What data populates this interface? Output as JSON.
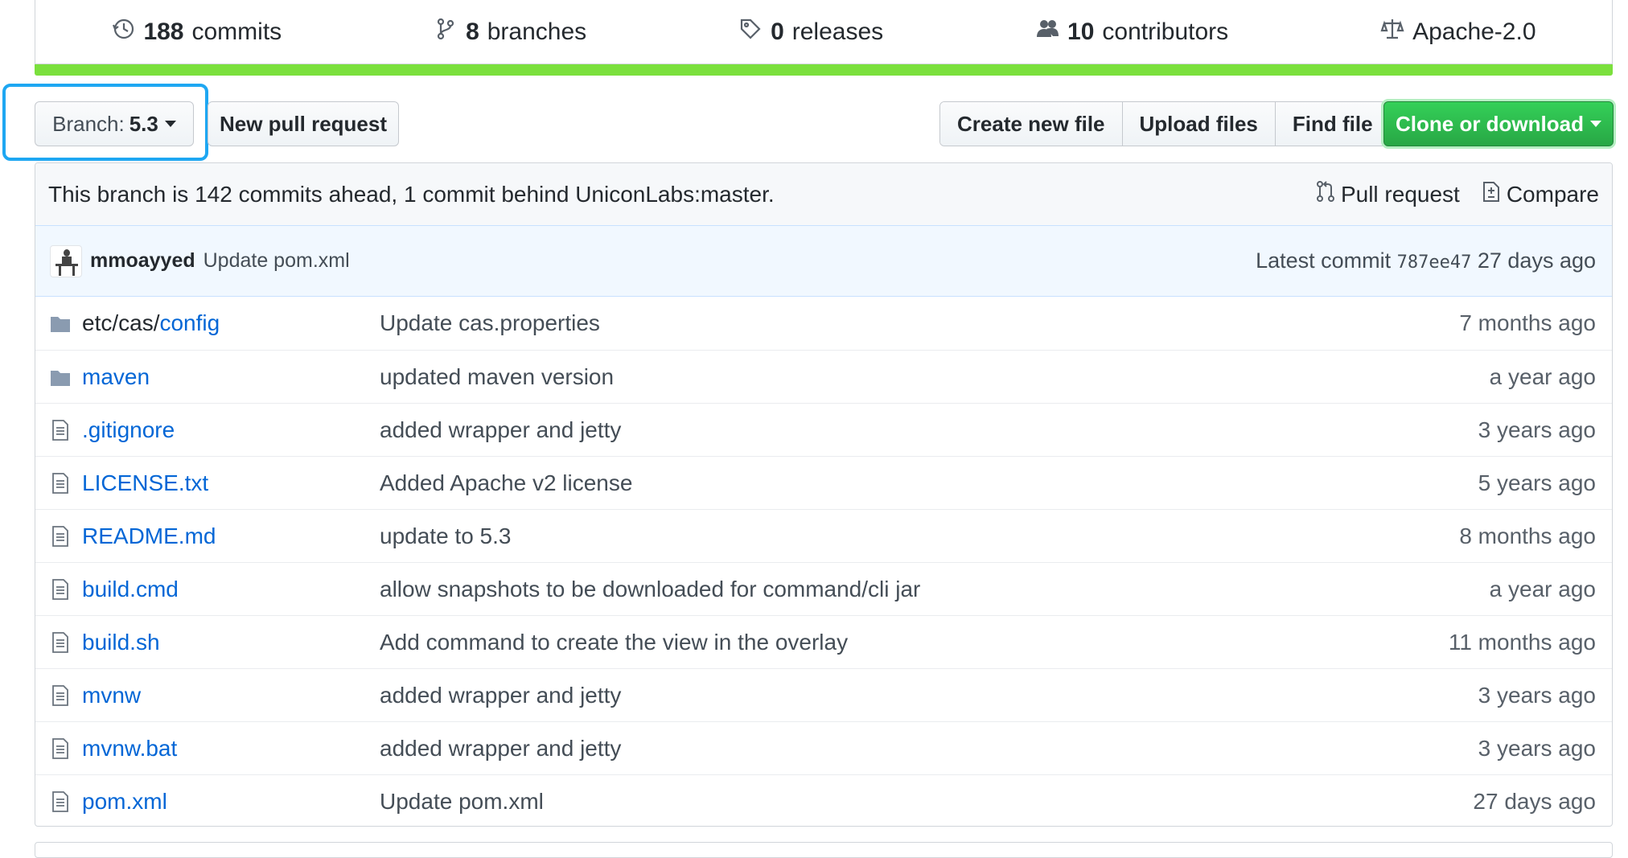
{
  "summary": {
    "commits_count": "188",
    "commits_label": "commits",
    "branches_count": "8",
    "branches_label": "branches",
    "releases_count": "0",
    "releases_label": "releases",
    "contributors_count": "10",
    "contributors_label": "contributors",
    "license": "Apache-2.0",
    "language_bar_color": "#7be03d"
  },
  "toolbar": {
    "branch_prefix": "Branch:",
    "branch_name": "5.3",
    "new_pull_request": "New pull request",
    "create_new_file": "Create new file",
    "upload_files": "Upload files",
    "find_file": "Find file",
    "clone_or_download": "Clone or download",
    "highlight_color": "#1ea7f2",
    "clone_color": "#28a745"
  },
  "branch_info": {
    "text": "This branch is 142 commits ahead, 1 commit behind UniconLabs:master.",
    "pull_request": "Pull request",
    "compare": "Compare"
  },
  "latest_commit": {
    "author": "mmoayyed",
    "message": "Update pom.xml",
    "label": "Latest commit",
    "sha": "787ee47",
    "age": "27 days ago"
  },
  "files": [
    {
      "type": "dir",
      "prefix": "etc/cas/",
      "name": "config",
      "message": "Update cas.properties",
      "age": "7 months ago"
    },
    {
      "type": "dir",
      "prefix": "",
      "name": "maven",
      "message": "updated maven version",
      "age": "a year ago"
    },
    {
      "type": "file",
      "prefix": "",
      "name": ".gitignore",
      "message": "added wrapper and jetty",
      "age": "3 years ago"
    },
    {
      "type": "file",
      "prefix": "",
      "name": "LICENSE.txt",
      "message": "Added Apache v2 license",
      "age": "5 years ago"
    },
    {
      "type": "file",
      "prefix": "",
      "name": "README.md",
      "message": "update to 5.3",
      "age": "8 months ago"
    },
    {
      "type": "file",
      "prefix": "",
      "name": "build.cmd",
      "message": "allow snapshots to be downloaded for command/cli jar",
      "age": "a year ago"
    },
    {
      "type": "file",
      "prefix": "",
      "name": "build.sh",
      "message": "Add command to create the view in the overlay",
      "age": "11 months ago"
    },
    {
      "type": "file",
      "prefix": "",
      "name": "mvnw",
      "message": "added wrapper and jetty",
      "age": "3 years ago"
    },
    {
      "type": "file",
      "prefix": "",
      "name": "mvnw.bat",
      "message": "added wrapper and jetty",
      "age": "3 years ago"
    },
    {
      "type": "file",
      "prefix": "",
      "name": "pom.xml",
      "message": "Update pom.xml",
      "age": "27 days ago"
    }
  ]
}
